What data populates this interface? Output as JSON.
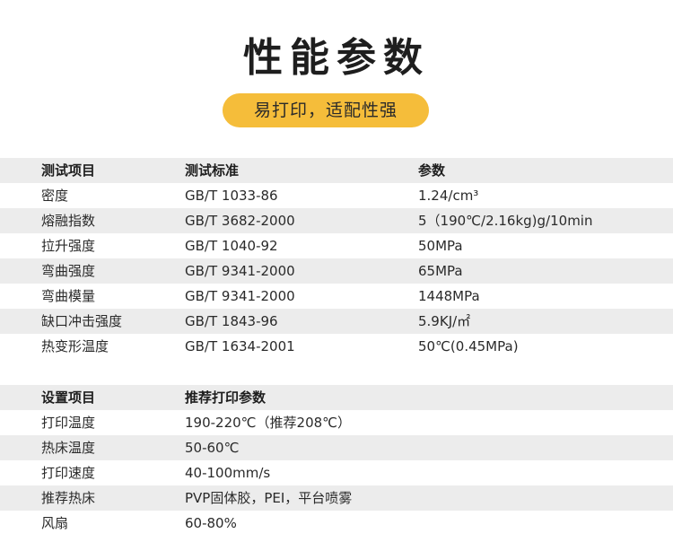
{
  "title": "性能参数",
  "subtitle": "易打印，适配性强",
  "table1": {
    "headers": [
      "测试项目",
      "测试标准",
      "参数"
    ],
    "rows": [
      [
        "密度",
        "GB/T 1033-86",
        "1.24/cm³"
      ],
      [
        "熔融指数",
        "GB/T 3682-2000",
        "5（190℃/2.16kg)g/10min"
      ],
      [
        "拉升强度",
        "GB/T 1040-92",
        "50MPa"
      ],
      [
        "弯曲强度",
        "GB/T 9341-2000",
        "65MPa"
      ],
      [
        "弯曲模量",
        "GB/T 9341-2000",
        "1448MPa"
      ],
      [
        "缺口冲击强度",
        "GB/T 1843-96",
        "5.9KJ/㎡"
      ],
      [
        "热变形温度",
        "GB/T 1634-2001",
        "50℃(0.45MPa)"
      ]
    ]
  },
  "table2": {
    "headers": [
      "设置项目",
      "推荐打印参数"
    ],
    "rows": [
      [
        "打印温度",
        "190-220℃（推荐208℃）"
      ],
      [
        "热床温度",
        "50-60℃"
      ],
      [
        "打印速度",
        "40-100mm/s"
      ],
      [
        "推荐热床",
        "PVP固体胶，PEI，平台喷雾"
      ],
      [
        "风扇",
        "60-80%"
      ]
    ]
  }
}
